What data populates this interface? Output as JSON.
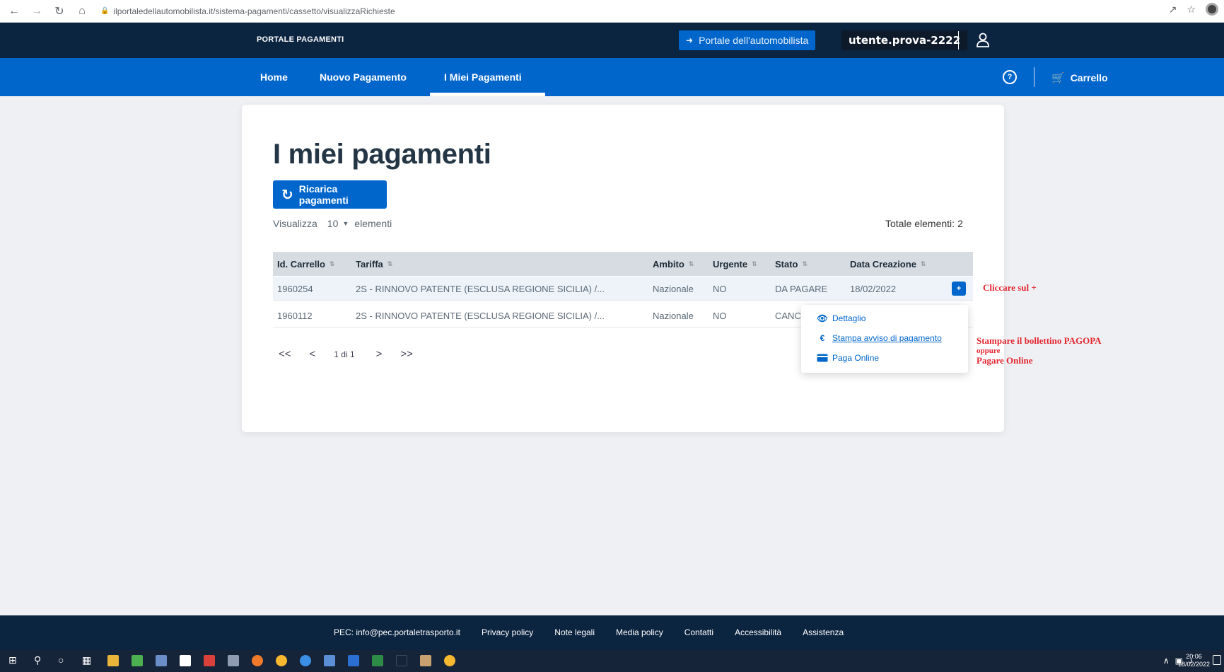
{
  "browser": {
    "url": "ilportaledellautomobilista.it/sistema-pagamenti/cassetto/visualizzaRichieste",
    "icons": [
      "back-icon",
      "forward-icon",
      "reload-icon",
      "home-icon",
      "lock-icon",
      "share-icon",
      "star-icon",
      "profile-avatar"
    ]
  },
  "header": {
    "title": "PORTALE PAGAMENTI",
    "portale_link": "Portale dell'automobilista",
    "username": "utente.prova-2222"
  },
  "nav": {
    "items": [
      {
        "label": "Home"
      },
      {
        "label": "Nuovo Pagamento"
      },
      {
        "label": "I Miei Pagamenti",
        "active": true
      }
    ],
    "help_glyph": "?",
    "cart_label": "Carrello"
  },
  "main": {
    "title": "I miei pagamenti",
    "reload_button": "Ricarica pagamenti",
    "show_prefix": "Visualizza",
    "page_size": "10",
    "show_suffix": "elementi",
    "total_label": "Totale elementi:",
    "total_value": "2"
  },
  "table": {
    "columns": [
      "Id. Carrello",
      "Tariffa",
      "Ambito",
      "Urgente",
      "Stato",
      "Data Creazione"
    ],
    "rows": [
      {
        "id": "1960254",
        "tariffa": "2S - RINNOVO PATENTE (ESCLUSA REGIONE SICILIA) /...",
        "ambito": "Nazionale",
        "urgente": "NO",
        "stato": "DA PAGARE",
        "data": "18/02/2022",
        "action": "+"
      },
      {
        "id": "1960112",
        "tariffa": "2S - RINNOVO PATENTE (ESCLUSA REGIONE SICILIA) /...",
        "ambito": "Nazionale",
        "urgente": "NO",
        "stato": "CANC",
        "data": ""
      }
    ]
  },
  "pagination": {
    "first": "<<",
    "prev": "<",
    "label": "1 di 1",
    "next": ">",
    "last": ">>"
  },
  "dropdown": {
    "items": [
      {
        "label": "Dettaglio",
        "icon": "eye-icon"
      },
      {
        "label": "Stampa avviso di pagamento",
        "icon": "euro-icon"
      },
      {
        "label": "Paga Online",
        "icon": "credit-card-icon"
      }
    ]
  },
  "annotations": {
    "click_plus": "Cliccare sul +",
    "line1": "Stampare il bollettino PAGOPA",
    "line2": "oppure",
    "line3": "Pagare Online"
  },
  "footer": {
    "links": [
      "PEC: info@pec.portaletrasporto.it",
      "Privacy policy",
      "Note legali",
      "Media policy",
      "Contatti",
      "Accessibilità",
      "Assistenza"
    ]
  },
  "taskbar": {
    "time": "20:06",
    "date": "18/02/2022"
  },
  "colors": {
    "dark_header": "#0b2440",
    "primary_blue": "#0066cc",
    "annotation_red": "#e3262f",
    "table_header": "#d7dce2"
  }
}
